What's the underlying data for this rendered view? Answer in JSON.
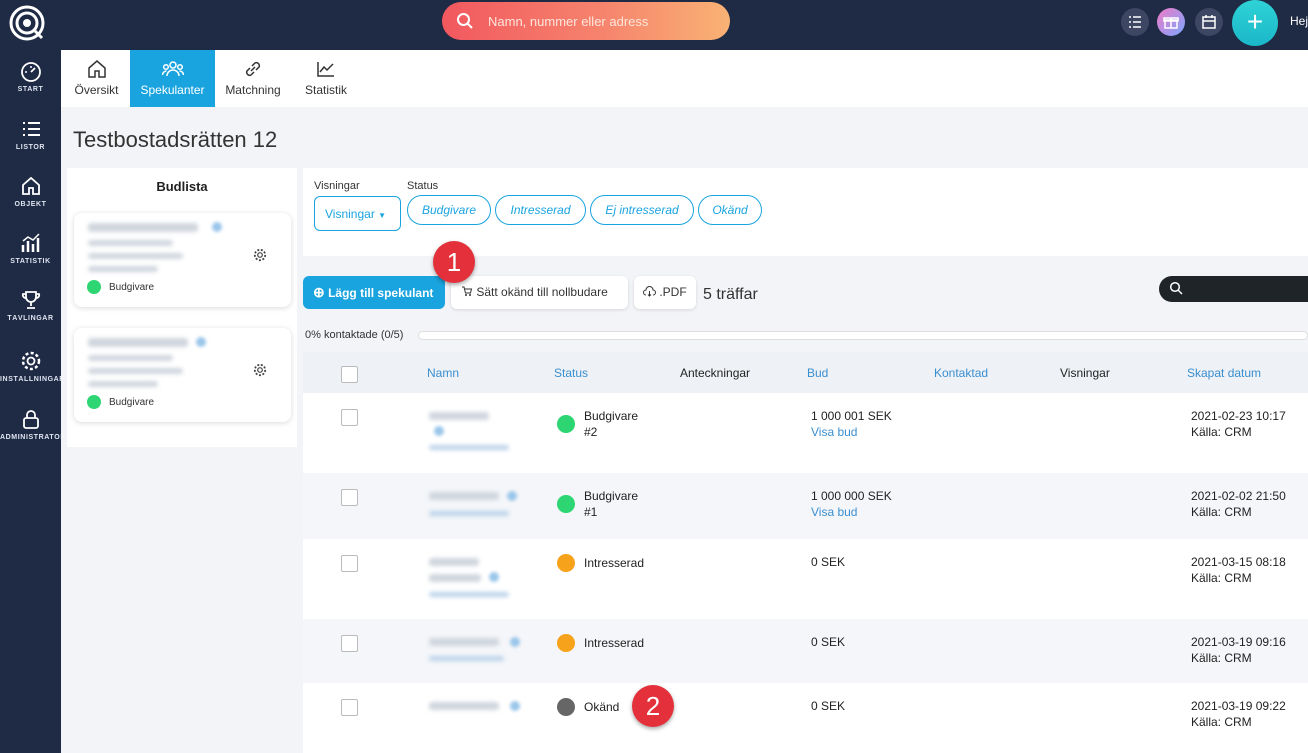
{
  "topbar": {
    "search_placeholder": "Namn, nummer eller adress",
    "greeting": "Hej",
    "plus": "+"
  },
  "leftnav": [
    {
      "label": "START",
      "icon": "dashboard-icon"
    },
    {
      "label": "LISTOR",
      "icon": "list-icon"
    },
    {
      "label": "OBJEKT",
      "icon": "home-icon"
    },
    {
      "label": "STATISTIK",
      "icon": "stats-icon"
    },
    {
      "label": "TÄVLINGAR",
      "icon": "trophy-icon"
    },
    {
      "label": "INSTÄLLNINGAR",
      "icon": "gear-icon"
    },
    {
      "label": "ADMINISTRATÖR",
      "icon": "lock-icon"
    }
  ],
  "tabs": [
    {
      "label": "Översikt",
      "icon": "home-icon"
    },
    {
      "label": "Spekulanter",
      "icon": "users-icon",
      "active": true
    },
    {
      "label": "Matchning",
      "icon": "link-icon"
    },
    {
      "label": "Statistik",
      "icon": "chart-icon"
    }
  ],
  "page_title": "Testbostadsrätten 12",
  "budlista": {
    "title": "Budlista",
    "cards": [
      {
        "status": "Budgivare",
        "status_color": "#2ed573"
      },
      {
        "status": "Budgivare",
        "status_color": "#2ed573"
      }
    ]
  },
  "filters": {
    "visningar_label": "Visningar",
    "visningar_button": "Visningar",
    "status_label": "Status",
    "status_pills": [
      "Budgivare",
      "Intresserad",
      "Ej intresserad",
      "Okänd"
    ]
  },
  "actions": {
    "add_label": "Lägg till spekulant",
    "set_unknown_label": "Sätt okänd till nollbudare",
    "pdf_label": ".PDF",
    "hits": "5 träffar"
  },
  "progress": {
    "label": "0% kontaktade (0/5)",
    "value": 0
  },
  "badges": [
    "1",
    "2"
  ],
  "table": {
    "headers": [
      "Namn",
      "Status",
      "Anteckningar",
      "Bud",
      "Kontaktad",
      "Visningar",
      "Skapat datum"
    ],
    "rows": [
      {
        "status": "Budgivare",
        "status2": "#2",
        "color": "#2ed573",
        "bud": "1 000 001 SEK",
        "visa_bud": "Visa bud",
        "date": "2021-02-23 10:17",
        "source": "Källa: CRM"
      },
      {
        "status": "Budgivare",
        "status2": "#1",
        "color": "#2ed573",
        "bud": "1 000 000 SEK",
        "visa_bud": "Visa bud",
        "date": "2021-02-02 21:50",
        "source": "Källa: CRM"
      },
      {
        "status": "Intresserad",
        "status2": "",
        "color": "#f7a21b",
        "bud": "0 SEK",
        "visa_bud": "",
        "date": "2021-03-15 08:18",
        "source": "Källa: CRM"
      },
      {
        "status": "Intresserad",
        "status2": "",
        "color": "#f7a21b",
        "bud": "0 SEK",
        "visa_bud": "",
        "date": "2021-03-19 09:16",
        "source": "Källa: CRM"
      },
      {
        "status": "Okänd",
        "status2": "",
        "color": "#666666",
        "bud": "0 SEK",
        "visa_bud": "",
        "date": "2021-03-19 09:22",
        "source": "Källa: CRM"
      }
    ]
  }
}
